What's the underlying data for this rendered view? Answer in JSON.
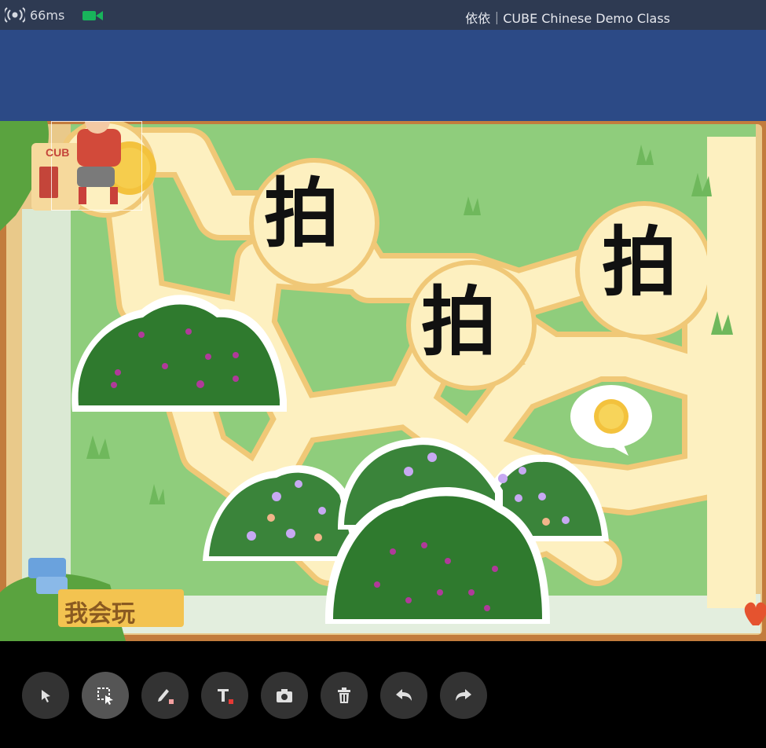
{
  "status_bar": {
    "ping": "66ms",
    "icons": [
      "signal-icon",
      "camera-icon"
    ],
    "title": "依依｜CUBE Chinese Demo Class"
  },
  "lesson": {
    "characters": [
      "拍",
      "拍",
      "拍"
    ],
    "corner_sticker": "我会玩",
    "logo_text": "CUB"
  },
  "toolbar": {
    "tools": [
      {
        "name": "pointer",
        "icon": "arrow-pointer-icon"
      },
      {
        "name": "select",
        "icon": "selection-icon",
        "active": true
      },
      {
        "name": "pen",
        "icon": "pen-icon"
      },
      {
        "name": "text",
        "icon": "text-icon"
      },
      {
        "name": "screenshot",
        "icon": "camera-icon"
      },
      {
        "name": "delete",
        "icon": "trash-icon"
      },
      {
        "name": "undo",
        "icon": "undo-icon"
      },
      {
        "name": "redo",
        "icon": "redo-icon"
      }
    ]
  },
  "colors": {
    "status_bg": "#2e3a52",
    "board_blue": "#2c4a86",
    "grass": "#8fcd7c",
    "path": "#fdf0c0",
    "bush": "#2f7a2e",
    "accent_red": "#e53935"
  }
}
